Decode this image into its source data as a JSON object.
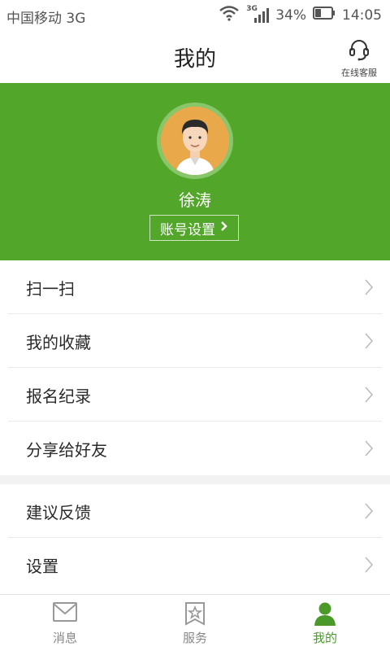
{
  "status_bar": {
    "carrier": "中国移动 3G",
    "network_badge": "3G",
    "battery": "34%",
    "time": "14:05"
  },
  "header": {
    "title": "我的",
    "customer_service": "在线客服"
  },
  "profile": {
    "username": "徐涛",
    "account_settings": "账号设置",
    "bg_color": "#52a629"
  },
  "menu": {
    "group1": [
      {
        "label": "扫一扫"
      },
      {
        "label": "我的收藏"
      },
      {
        "label": "报名纪录"
      },
      {
        "label": "分享给好友"
      }
    ],
    "group2": [
      {
        "label": "建议反馈"
      },
      {
        "label": "设置"
      }
    ]
  },
  "tabbar": {
    "tabs": [
      {
        "label": "消息",
        "icon": "envelope-icon"
      },
      {
        "label": "服务",
        "icon": "star-bookmark-icon"
      },
      {
        "label": "我的",
        "icon": "person-icon",
        "active": true
      }
    ],
    "active_color": "#4a9a2a"
  }
}
